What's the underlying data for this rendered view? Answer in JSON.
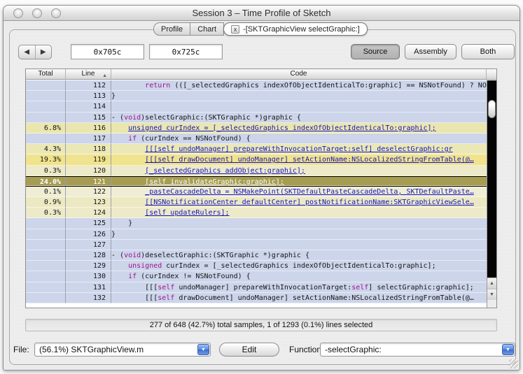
{
  "window": {
    "title": "Session 3 – Time Profile of Sketch",
    "close_icon": "",
    "minimize_icon": "",
    "zoom_icon": ""
  },
  "tabs": {
    "profile_label": "Profile",
    "chart_label": "Chart",
    "active_label": "-[SKTGraphicView selectGraphic:]",
    "close_icon": "x"
  },
  "toolbar": {
    "back_icon": "◀",
    "forward_icon": "▶",
    "address_start": "0x705c",
    "address_end": "0x725c",
    "source_label": "Source",
    "assembly_label": "Assembly",
    "both_label": "Both"
  },
  "table": {
    "col_total": "Total",
    "col_line": "Line",
    "col_code": "Code",
    "sort_icon": "▲",
    "default_row_bg": "#ccd5ea",
    "selected_row_bg": "#a79d52",
    "rows": [
      {
        "line": "112",
        "total": "",
        "kind": "plain",
        "bg": "#ccd5ea",
        "code": "        return (([_selectedGraphics indexOfObjectIdenticalTo:graphic] == NSNotFound) ? NO…"
      },
      {
        "line": "113",
        "total": "",
        "kind": "plain",
        "bg": "#ccd5ea",
        "code": "}"
      },
      {
        "line": "114",
        "total": "",
        "kind": "plain",
        "bg": "#ccd5ea",
        "code": ""
      },
      {
        "line": "115",
        "total": "",
        "kind": "plain",
        "bg": "#ccd5ea",
        "code": "- (void)selectGraphic:(SKTGraphic *)graphic {"
      },
      {
        "line": "116",
        "total": "6.8%",
        "kind": "link",
        "bg": "#eae6ad",
        "code": "    unsigned curIndex = [_selectedGraphics indexOfObjectIdenticalTo:graphic];"
      },
      {
        "line": "117",
        "total": "",
        "kind": "plain",
        "bg": "#ccd5ea",
        "code": "    if (curIndex == NSNotFound) {"
      },
      {
        "line": "118",
        "total": "4.3%",
        "kind": "link",
        "bg": "#ebe8b6",
        "code": "        [[[self undoManager] prepareWithInvocationTarget:self] deselectGraphic:gr"
      },
      {
        "line": "119",
        "total": "19.3%",
        "kind": "link",
        "bg": "#f0e38d",
        "code": "        [[[self drawDocument] undoManager] setActionName:NSLocalizedStringFromTable(@…"
      },
      {
        "line": "120",
        "total": "0.3%",
        "kind": "link",
        "bg": "#edeac9",
        "code": "        [_selectedGraphics addObject:graphic];"
      },
      {
        "line": "121",
        "total": "24.0%",
        "kind": "link",
        "selected": true,
        "bg": "#a79d52",
        "code": "        [self invalidateGraphic:graphic];"
      },
      {
        "line": "122",
        "total": "0.1%",
        "kind": "link",
        "bg": "#efedd4",
        "code": "        _pasteCascadeDelta = NSMakePoint(SKTDefaultPasteCascadeDelta, SKTDefaultPaste…"
      },
      {
        "line": "123",
        "total": "0.9%",
        "kind": "link",
        "bg": "#ece9c2",
        "code": "        [[NSNotificationCenter defaultCenter] postNotificationName:SKTGraphicViewSele…"
      },
      {
        "line": "124",
        "total": "0.3%",
        "kind": "link",
        "bg": "#edeac9",
        "code": "        [self updateRulers];"
      },
      {
        "line": "125",
        "total": "",
        "kind": "plain",
        "bg": "#ccd5ea",
        "code": "    }"
      },
      {
        "line": "126",
        "total": "",
        "kind": "plain",
        "bg": "#ccd5ea",
        "code": "}"
      },
      {
        "line": "127",
        "total": "",
        "kind": "plain",
        "bg": "#ccd5ea",
        "code": ""
      },
      {
        "line": "128",
        "total": "",
        "kind": "plain",
        "bg": "#ccd5ea",
        "code": "- (void)deselectGraphic:(SKTGraphic *)graphic {"
      },
      {
        "line": "129",
        "total": "",
        "kind": "plain",
        "bg": "#ccd5ea",
        "code": "    unsigned curIndex = [_selectedGraphics indexOfObjectIdenticalTo:graphic];"
      },
      {
        "line": "130",
        "total": "",
        "kind": "plain",
        "bg": "#ccd5ea",
        "code": "    if (curIndex != NSNotFound) {"
      },
      {
        "line": "131",
        "total": "",
        "kind": "plain",
        "bg": "#ccd5ea",
        "code": "        [[[self undoManager] prepareWithInvocationTarget:self] selectGraphic:graphic];"
      },
      {
        "line": "132",
        "total": "",
        "kind": "plain",
        "bg": "#ccd5ea",
        "code": "        [[[self drawDocument] undoManager] setActionName:NSLocalizedStringFromTable(@…"
      }
    ]
  },
  "syntax": {
    "keywords": [
      "return",
      "if",
      "void",
      "unsigned",
      "self"
    ],
    "keyword_color": "#a0128f",
    "link_color": "#1414c4"
  },
  "scrollbar": {
    "up_icon": "▲",
    "down_icon": "▼"
  },
  "status_bar": {
    "text": "277 of 648 (42.7%) total samples, 1 of 1293 (0.1%) lines selected"
  },
  "footer": {
    "file_label": "File:",
    "file_value": "(56.1%) SKTGraphicView.m",
    "edit_label": "Edit",
    "function_label": "Function:",
    "function_value": "-selectGraphic:",
    "dropdown_icon": "▼"
  }
}
